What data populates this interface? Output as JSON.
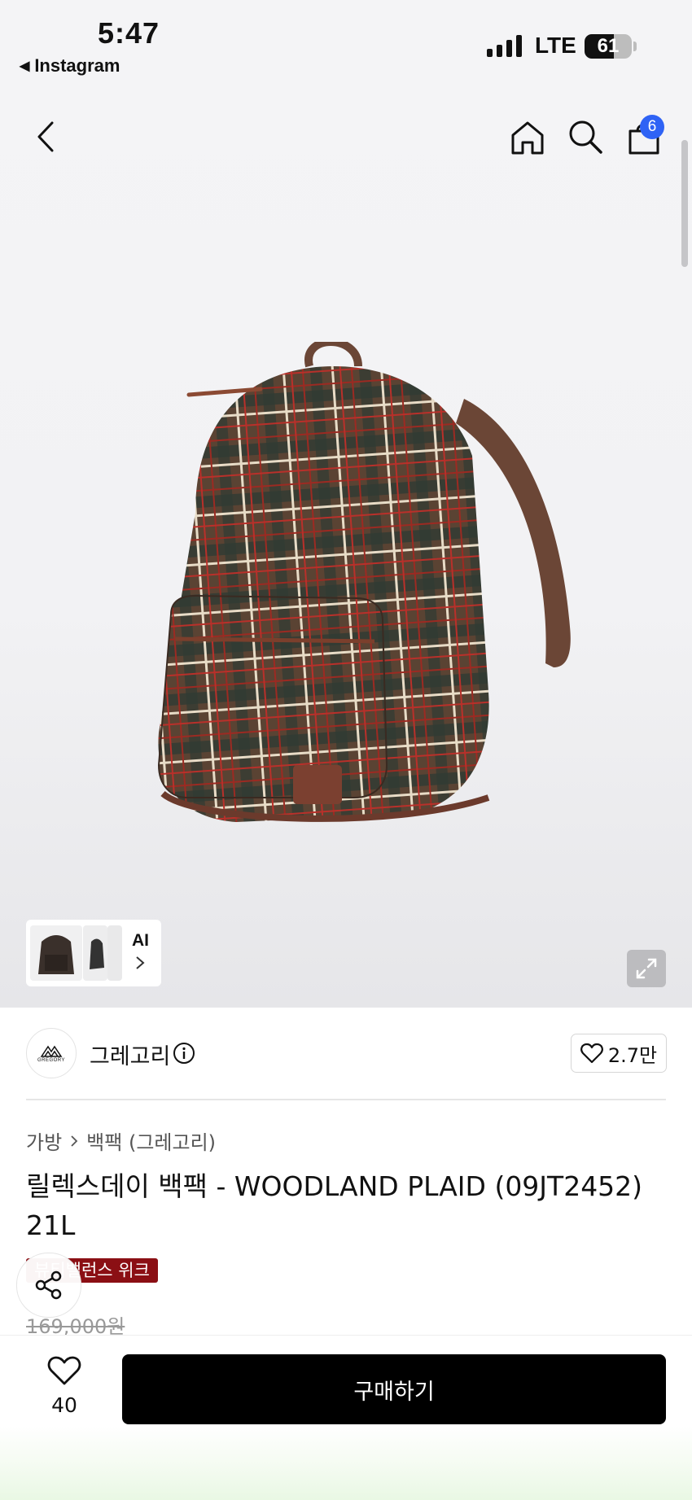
{
  "status_bar": {
    "time": "5:47",
    "back_app": "Instagram",
    "network": "LTE",
    "battery": "61"
  },
  "nav": {
    "cart_count": "6"
  },
  "gallery": {
    "ai_label": "AI"
  },
  "brand": {
    "name": "그레고리",
    "logo_text": "GREGORY",
    "likes": "2.7만"
  },
  "breadcrumb": [
    "가방",
    "백팩 (그레고리)"
  ],
  "product": {
    "title": "릴렉스데이 백팩 - WOODLAND PLAID (09JT2452) 21L",
    "badge": "뷰티밸런스 위크",
    "original_price": "169,000원"
  },
  "bottom": {
    "wish_count": "40",
    "buy_label": "구매하기"
  },
  "colors": {
    "accent_blue": "#2f63f5",
    "badge_red": "#8b0f14",
    "buy_button": "#000000"
  }
}
